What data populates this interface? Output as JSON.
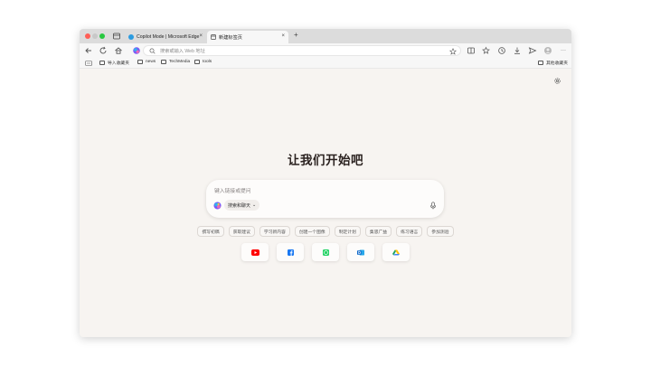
{
  "browser": {
    "tabs": [
      {
        "label": "Copilot Mode | Microsoft Edge",
        "active": false
      },
      {
        "label": "新建标签页",
        "active": true
      }
    ],
    "new_tab_symbol": "+",
    "close_symbol": "×",
    "address_placeholder": "搜索或输入 Web 地址",
    "menu_symbol": "···"
  },
  "bookmarks": {
    "import_label": "导入收藏夹",
    "folders": [
      "news",
      "TechMedia",
      "tools"
    ],
    "other_label": "其他收藏夹"
  },
  "main": {
    "title": "让我们开始吧",
    "search_placeholder": "键入链接或提问",
    "chat_button_label": "搜索和聊天",
    "chat_button_chevron": "⌄",
    "suggestions": [
      "撰写初稿",
      "获取建议",
      "学习新内容",
      "创建一个图像",
      "制定计划",
      "集思广益",
      "练习语言",
      "参加测验"
    ],
    "tiles": [
      {
        "name": "youtube",
        "color": "#ff0000"
      },
      {
        "name": "facebook",
        "color": "#1877f2"
      },
      {
        "name": "whatsapp",
        "color": "#25d366"
      },
      {
        "name": "outlook",
        "color": "#0a64c8"
      },
      {
        "name": "drive",
        "color": "#4285f4"
      }
    ]
  },
  "colors": {
    "accent": "#0078d4",
    "background": "#f7f4f1"
  }
}
